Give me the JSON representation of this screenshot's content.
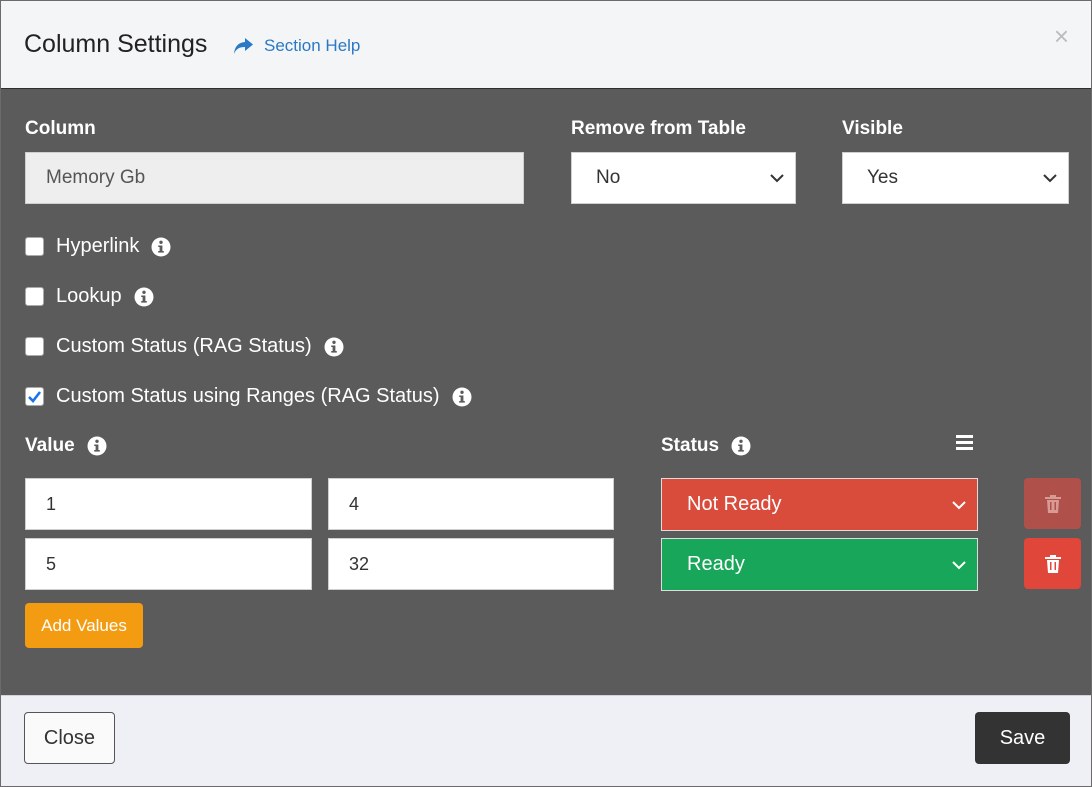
{
  "header": {
    "title": "Column Settings",
    "help_label": "Section Help",
    "close_glyph": "×"
  },
  "form": {
    "column_label": "Column",
    "column_value": "Memory Gb",
    "remove_label": "Remove from Table",
    "remove_value": "No",
    "visible_label": "Visible",
    "visible_value": "Yes"
  },
  "checkboxes": [
    {
      "label": "Hyperlink",
      "checked": false
    },
    {
      "label": "Lookup",
      "checked": false
    },
    {
      "label": "Custom Status (RAG Status)",
      "checked": false
    },
    {
      "label": "Custom Status using Ranges (RAG Status)",
      "checked": true
    }
  ],
  "ranges": {
    "value_label": "Value",
    "status_label": "Status",
    "rows": [
      {
        "from": "1",
        "to": "4",
        "status": "Not Ready",
        "status_color": "#d94b3a"
      },
      {
        "from": "5",
        "to": "32",
        "status": "Ready",
        "status_color": "#18a65a"
      }
    ],
    "add_label": "Add Values"
  },
  "footer": {
    "close_label": "Close",
    "save_label": "Save"
  },
  "colors": {
    "accent_link": "#2b78c5",
    "add_button": "#f39c12",
    "delete_button": "#e0463a",
    "delete_button_disabled": "#b0504a"
  }
}
